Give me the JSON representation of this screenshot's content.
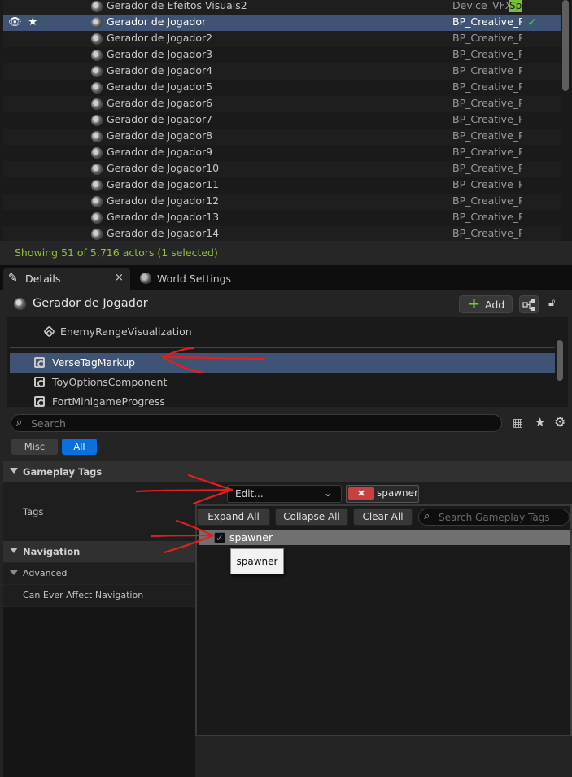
{
  "outliner": {
    "rows": [
      {
        "label": "Gerador de Efeitos Visuais2",
        "type": "Device_VFX",
        "type_highlight": "Sp"
      },
      {
        "label": "Gerador de Jogador",
        "type": "BP_Creative_Pl",
        "selected": true
      },
      {
        "label": "Gerador de Jogador2",
        "type": "BP_Creative_Pl"
      },
      {
        "label": "Gerador de Jogador3",
        "type": "BP_Creative_Pl"
      },
      {
        "label": "Gerador de Jogador4",
        "type": "BP_Creative_Pl"
      },
      {
        "label": "Gerador de Jogador5",
        "type": "BP_Creative_Pl"
      },
      {
        "label": "Gerador de Jogador6",
        "type": "BP_Creative_Pl"
      },
      {
        "label": "Gerador de Jogador7",
        "type": "BP_Creative_Pl"
      },
      {
        "label": "Gerador de Jogador8",
        "type": "BP_Creative_Pl"
      },
      {
        "label": "Gerador de Jogador9",
        "type": "BP_Creative_Pl"
      },
      {
        "label": "Gerador de Jogador10",
        "type": "BP_Creative_Pl"
      },
      {
        "label": "Gerador de Jogador11",
        "type": "BP_Creative_Pl"
      },
      {
        "label": "Gerador de Jogador12",
        "type": "BP_Creative_Pl"
      },
      {
        "label": "Gerador de Jogador13",
        "type": "BP_Creative_Pl"
      },
      {
        "label": "Gerador de Jogador14",
        "type": "BP_Creative_Pl"
      }
    ],
    "status": "Showing 51 of 5,716 actors (1 selected)",
    "check_color": "#37c744"
  },
  "tabs": {
    "details": "Details",
    "close_glyph": "×",
    "world_settings": "World Settings"
  },
  "details": {
    "title": "Gerador de Jogador",
    "add_label": "Add",
    "components": [
      {
        "label": "EnemyRangeVisualization",
        "icon": "cube-icon"
      },
      {
        "label": "VerseTagMarkup",
        "icon": "component-icon",
        "selected": true
      },
      {
        "label": "ToyOptionsComponent",
        "icon": "component-icon"
      },
      {
        "label": "FortMinigameProgress",
        "icon": "component-icon"
      }
    ],
    "search_placeholder": "Search",
    "filters": {
      "misc": "Misc",
      "all": "All"
    },
    "accent_color": "#0a70e0",
    "sections": {
      "gameplay_tags": "Gameplay Tags",
      "tags": "Tags",
      "navigation": "Navigation",
      "advanced": "Advanced",
      "can_affect_navigation": "Can Ever Affect Navigation"
    },
    "tags_editor": {
      "edit_label": "Edit...",
      "chip_label": "spawner",
      "expand_all": "Expand All",
      "collapse_all": "Collapse All",
      "clear_all": "Clear All",
      "search_placeholder": "Search Gameplay Tags",
      "tag_item": "spawner",
      "tag_checked": true,
      "tooltip": "spawner"
    }
  }
}
